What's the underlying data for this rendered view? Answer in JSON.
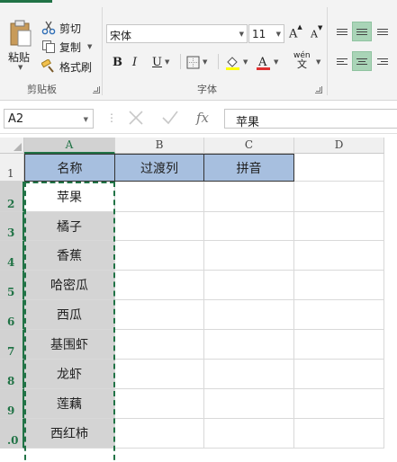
{
  "ribbon": {
    "clipboard": {
      "paste_label": "粘贴",
      "cut_label": "剪切",
      "copy_label": "复制",
      "format_painter_label": "格式刷",
      "group_label": "剪贴板"
    },
    "font": {
      "font_name": "宋体",
      "font_size": "11",
      "grow_font": "A",
      "shrink_font": "A",
      "bold": "B",
      "italic": "I",
      "underline": "U",
      "phonetic_top": "wén",
      "phonetic_bottom": "文",
      "group_label": "字体",
      "font_color": "#e03030",
      "fill_color": "#ffff00"
    }
  },
  "formula_bar": {
    "name_box": "A2",
    "formula": "苹果"
  },
  "columns": [
    "A",
    "B",
    "C",
    "D"
  ],
  "rows": [
    "1",
    "2",
    "3",
    "4",
    "5",
    "6",
    "7",
    "8",
    "9",
    ".0"
  ],
  "header_row": [
    "名称",
    "过渡列",
    "拼音"
  ],
  "column_a_values": [
    "苹果",
    "橘子",
    "香蕉",
    "哈密瓜",
    "西瓜",
    "基围虾",
    "龙虾",
    "莲藕",
    "西红柿"
  ],
  "colors": {
    "accent_green": "#217346",
    "header_fill": "#a7bfdf",
    "selection_fill": "#d4d4d4"
  }
}
